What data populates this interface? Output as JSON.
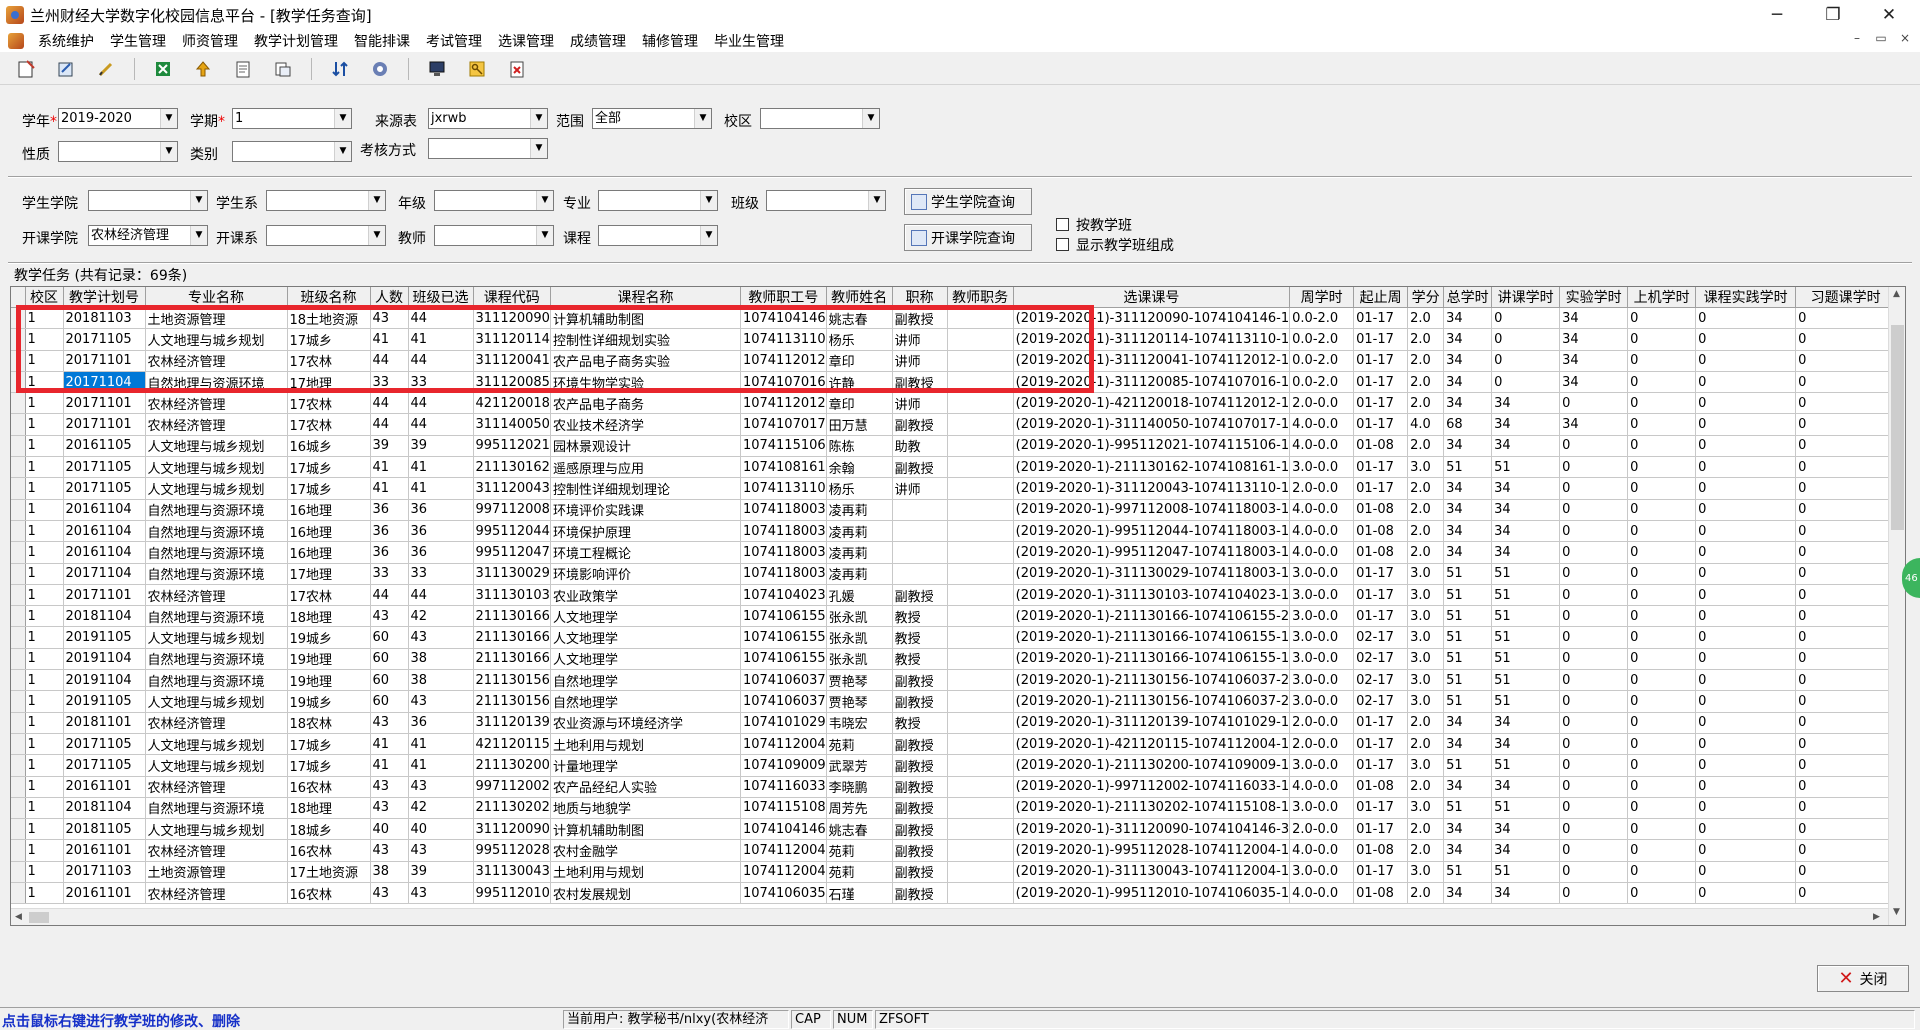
{
  "window": {
    "title": "兰州财经大学数字化校园信息平台 - [教学任务查询]",
    "minimize": "─",
    "maximize": "❐",
    "close": "✕"
  },
  "menu": [
    "系统维护",
    "学生管理",
    "师资管理",
    "教学计划管理",
    "智能排课",
    "考试管理",
    "选课管理",
    "成绩管理",
    "辅修管理",
    "毕业生管理"
  ],
  "mdi_controls": [
    "–",
    "▭",
    "×"
  ],
  "filters": {
    "year_label": "学年",
    "year_value": "2019-2020",
    "term_label": "学期",
    "term_value": "1",
    "source_label": "来源表",
    "source_value": "jxrwb",
    "scope_label": "范围",
    "scope_value": "全部",
    "campus_label": "校区",
    "campus_value": "",
    "nature_label": "性质",
    "nature_value": "",
    "category_label": "类别",
    "category_value": "",
    "exam_label": "考核方式",
    "exam_value": "",
    "stu_college_label": "学生学院",
    "stu_college_value": "",
    "stu_dept_label": "学生系",
    "stu_dept_value": "",
    "grade_label": "年级",
    "grade_value": "",
    "major_label": "专业",
    "major_value": "",
    "class_label": "班级",
    "class_value": "",
    "open_college_label": "开课学院",
    "open_college_value": "农林经济管理",
    "open_dept_label": "开课系",
    "open_dept_value": "",
    "teacher_label": "教师",
    "teacher_value": "",
    "course_label": "课程",
    "course_value": "",
    "stu_college_query": "学生学院查询",
    "open_college_query": "开课学院查询",
    "by_class_label": "按教学班",
    "show_class_label": "显示教学班组成"
  },
  "grid": {
    "caption": "教学任务 (共有记录：69条)",
    "columns": [
      "校区",
      "教学计划号",
      "专业名称",
      "班级名称",
      "人数",
      "班级已选",
      "课程代码",
      "课程名称",
      "教师职工号",
      "教师姓名",
      "职称",
      "教师职务",
      "选课课号",
      "周学时",
      "起止周",
      "学分",
      "总学时",
      "讲课学时",
      "实验学时",
      "上机学时",
      "课程实践学时",
      "习题课学时"
    ],
    "selected_row": 3,
    "rows": [
      [
        "1",
        "20181103",
        "土地资源管理",
        "18土地资源",
        "43",
        "44",
        "311120090",
        "计算机辅助制图",
        "1074104146",
        "姚志春",
        "副教授",
        "",
        "(2019-2020-1)-311120090-1074104146-1",
        "0.0-2.0",
        "01-17",
        "2.0",
        "34",
        "0",
        "34",
        "0",
        "0",
        "0"
      ],
      [
        "1",
        "20171105",
        "人文地理与城乡规划",
        "17城乡",
        "41",
        "41",
        "311120114",
        "控制性详细规划实验",
        "1074113110",
        "杨乐",
        "讲师",
        "",
        "(2019-2020-1)-311120114-1074113110-1",
        "0.0-2.0",
        "01-17",
        "2.0",
        "34",
        "0",
        "34",
        "0",
        "0",
        "0"
      ],
      [
        "1",
        "20171101",
        "农林经济管理",
        "17农林",
        "44",
        "44",
        "311120041",
        "农产品电子商务实验",
        "1074112012",
        "章印",
        "讲师",
        "",
        "(2019-2020-1)-311120041-1074112012-1",
        "0.0-2.0",
        "01-17",
        "2.0",
        "34",
        "0",
        "34",
        "0",
        "0",
        "0"
      ],
      [
        "1",
        "20171104",
        "自然地理与资源环境",
        "17地理",
        "33",
        "33",
        "311120085",
        "环境生物学实验",
        "1074107016",
        "许静",
        "副教授",
        "",
        "(2019-2020-1)-311120085-1074107016-1",
        "0.0-2.0",
        "01-17",
        "2.0",
        "34",
        "0",
        "34",
        "0",
        "0",
        "0"
      ],
      [
        "1",
        "20171101",
        "农林经济管理",
        "17农林",
        "44",
        "44",
        "421120018",
        "农产品电子商务",
        "1074112012",
        "章印",
        "讲师",
        "",
        "(2019-2020-1)-421120018-1074112012-1",
        "2.0-0.0",
        "01-17",
        "2.0",
        "34",
        "34",
        "0",
        "0",
        "0",
        "0"
      ],
      [
        "1",
        "20171101",
        "农林经济管理",
        "17农林",
        "44",
        "44",
        "311140050",
        "农业技术经济学",
        "1074107017",
        "田万慧",
        "副教授",
        "",
        "(2019-2020-1)-311140050-1074107017-1",
        "4.0-0.0",
        "01-17",
        "4.0",
        "68",
        "34",
        "34",
        "0",
        "0",
        "0"
      ],
      [
        "1",
        "20161105",
        "人文地理与城乡规划",
        "16城乡",
        "39",
        "39",
        "995112021",
        "园林景观设计",
        "1074115106",
        "陈栋",
        "助教",
        "",
        "(2019-2020-1)-995112021-1074115106-1",
        "4.0-0.0",
        "01-08",
        "2.0",
        "34",
        "34",
        "0",
        "0",
        "0",
        "0"
      ],
      [
        "1",
        "20171105",
        "人文地理与城乡规划",
        "17城乡",
        "41",
        "41",
        "211130162",
        "遥感原理与应用",
        "1074108161",
        "余翰",
        "副教授",
        "",
        "(2019-2020-1)-211130162-1074108161-1",
        "3.0-0.0",
        "01-17",
        "3.0",
        "51",
        "51",
        "0",
        "0",
        "0",
        "0"
      ],
      [
        "1",
        "20171105",
        "人文地理与城乡规划",
        "17城乡",
        "41",
        "41",
        "311120043",
        "控制性详细规划理论",
        "1074113110",
        "杨乐",
        "讲师",
        "",
        "(2019-2020-1)-311120043-1074113110-1",
        "2.0-0.0",
        "01-17",
        "2.0",
        "34",
        "34",
        "0",
        "0",
        "0",
        "0"
      ],
      [
        "1",
        "20161104",
        "自然地理与资源环境",
        "16地理",
        "36",
        "36",
        "997112008",
        "环境评价实践课",
        "1074118003",
        "凌再莉",
        "",
        "",
        "(2019-2020-1)-997112008-1074118003-1",
        "4.0-0.0",
        "01-08",
        "2.0",
        "34",
        "34",
        "0",
        "0",
        "0",
        "0"
      ],
      [
        "1",
        "20161104",
        "自然地理与资源环境",
        "16地理",
        "36",
        "36",
        "995112044",
        "环境保护原理",
        "1074118003",
        "凌再莉",
        "",
        "",
        "(2019-2020-1)-995112044-1074118003-1",
        "4.0-0.0",
        "01-08",
        "2.0",
        "34",
        "34",
        "0",
        "0",
        "0",
        "0"
      ],
      [
        "1",
        "20161104",
        "自然地理与资源环境",
        "16地理",
        "36",
        "36",
        "995112047",
        "环境工程概论",
        "1074118003",
        "凌再莉",
        "",
        "",
        "(2019-2020-1)-995112047-1074118003-1",
        "4.0-0.0",
        "01-08",
        "2.0",
        "34",
        "34",
        "0",
        "0",
        "0",
        "0"
      ],
      [
        "1",
        "20171104",
        "自然地理与资源环境",
        "17地理",
        "33",
        "33",
        "311130029",
        "环境影响评价",
        "1074118003",
        "凌再莉",
        "",
        "",
        "(2019-2020-1)-311130029-1074118003-1",
        "3.0-0.0",
        "01-17",
        "3.0",
        "51",
        "51",
        "0",
        "0",
        "0",
        "0"
      ],
      [
        "1",
        "20171101",
        "农林经济管理",
        "17农林",
        "44",
        "44",
        "311130103",
        "农业政策学",
        "1074104023",
        "孔媛",
        "副教授",
        "",
        "(2019-2020-1)-311130103-1074104023-1",
        "3.0-0.0",
        "01-17",
        "3.0",
        "51",
        "51",
        "0",
        "0",
        "0",
        "0"
      ],
      [
        "1",
        "20181104",
        "自然地理与资源环境",
        "18地理",
        "43",
        "42",
        "211130166",
        "人文地理学",
        "1074106155",
        "张永凯",
        "教授",
        "",
        "(2019-2020-1)-211130166-1074106155-2",
        "3.0-0.0",
        "01-17",
        "3.0",
        "51",
        "51",
        "0",
        "0",
        "0",
        "0"
      ],
      [
        "1",
        "20191105",
        "人文地理与城乡规划",
        "19城乡",
        "60",
        "43",
        "211130166",
        "人文地理学",
        "1074106155",
        "张永凯",
        "教授",
        "",
        "(2019-2020-1)-211130166-1074106155-1",
        "3.0-0.0",
        "02-17",
        "3.0",
        "51",
        "51",
        "0",
        "0",
        "0",
        "0"
      ],
      [
        "1",
        "20191104",
        "自然地理与资源环境",
        "19地理",
        "60",
        "38",
        "211130166",
        "人文地理学",
        "1074106155",
        "张永凯",
        "教授",
        "",
        "(2019-2020-1)-211130166-1074106155-1",
        "3.0-0.0",
        "02-17",
        "3.0",
        "51",
        "51",
        "0",
        "0",
        "0",
        "0"
      ],
      [
        "1",
        "20191104",
        "自然地理与资源环境",
        "19地理",
        "60",
        "38",
        "211130156",
        "自然地理学",
        "1074106037",
        "贾艳琴",
        "副教授",
        "",
        "(2019-2020-1)-211130156-1074106037-2",
        "3.0-0.0",
        "02-17",
        "3.0",
        "51",
        "51",
        "0",
        "0",
        "0",
        "0"
      ],
      [
        "1",
        "20191105",
        "人文地理与城乡规划",
        "19城乡",
        "60",
        "43",
        "211130156",
        "自然地理学",
        "1074106037",
        "贾艳琴",
        "副教授",
        "",
        "(2019-2020-1)-211130156-1074106037-2",
        "3.0-0.0",
        "02-17",
        "3.0",
        "51",
        "51",
        "0",
        "0",
        "0",
        "0"
      ],
      [
        "1",
        "20181101",
        "农林经济管理",
        "18农林",
        "43",
        "36",
        "311120139",
        "农业资源与环境经济学",
        "1074101029",
        "韦晓宏",
        "教授",
        "",
        "(2019-2020-1)-311120139-1074101029-1",
        "2.0-0.0",
        "01-17",
        "2.0",
        "34",
        "34",
        "0",
        "0",
        "0",
        "0"
      ],
      [
        "1",
        "20171105",
        "人文地理与城乡规划",
        "17城乡",
        "41",
        "41",
        "421120115",
        "土地利用与规划",
        "1074112004",
        "苑莉",
        "副教授",
        "",
        "(2019-2020-1)-421120115-1074112004-1",
        "2.0-0.0",
        "01-17",
        "2.0",
        "34",
        "34",
        "0",
        "0",
        "0",
        "0"
      ],
      [
        "1",
        "20171105",
        "人文地理与城乡规划",
        "17城乡",
        "41",
        "41",
        "211130200",
        "计量地理学",
        "1074109009",
        "武翠芳",
        "副教授",
        "",
        "(2019-2020-1)-211130200-1074109009-1",
        "3.0-0.0",
        "01-17",
        "3.0",
        "51",
        "51",
        "0",
        "0",
        "0",
        "0"
      ],
      [
        "1",
        "20161101",
        "农林经济管理",
        "16农林",
        "43",
        "43",
        "997112002",
        "农产品经纪人实验",
        "1074116033",
        "李晓鹏",
        "副教授",
        "",
        "(2019-2020-1)-997112002-1074116033-1",
        "4.0-0.0",
        "01-08",
        "2.0",
        "34",
        "34",
        "0",
        "0",
        "0",
        "0"
      ],
      [
        "1",
        "20181104",
        "自然地理与资源环境",
        "18地理",
        "43",
        "42",
        "211130202",
        "地质与地貌学",
        "1074115108",
        "周芳先",
        "副教授",
        "",
        "(2019-2020-1)-211130202-1074115108-1",
        "3.0-0.0",
        "01-17",
        "3.0",
        "51",
        "51",
        "0",
        "0",
        "0",
        "0"
      ],
      [
        "1",
        "20181105",
        "人文地理与城乡规划",
        "18城乡",
        "40",
        "40",
        "311120090",
        "计算机辅助制图",
        "1074104146",
        "姚志春",
        "副教授",
        "",
        "(2019-2020-1)-311120090-1074104146-3",
        "2.0-0.0",
        "01-17",
        "2.0",
        "34",
        "34",
        "0",
        "0",
        "0",
        "0"
      ],
      [
        "1",
        "20161101",
        "农林经济管理",
        "16农林",
        "43",
        "43",
        "995112028",
        "农村金融学",
        "1074112004",
        "苑莉",
        "副教授",
        "",
        "(2019-2020-1)-995112028-1074112004-1",
        "4.0-0.0",
        "01-08",
        "2.0",
        "34",
        "34",
        "0",
        "0",
        "0",
        "0"
      ],
      [
        "1",
        "20171103",
        "土地资源管理",
        "17土地资源",
        "38",
        "39",
        "311130043",
        "土地利用与规划",
        "1074112004",
        "苑莉",
        "副教授",
        "",
        "(2019-2020-1)-311130043-1074112004-1",
        "3.0-0.0",
        "01-17",
        "3.0",
        "51",
        "51",
        "0",
        "0",
        "0",
        "0"
      ],
      [
        "1",
        "20161101",
        "农林经济管理",
        "16农林",
        "43",
        "43",
        "995112010",
        "农村发展规划",
        "1074106035",
        "石瑾",
        "副教授",
        "",
        "(2019-2020-1)-995112010-1074106035-1",
        "4.0-0.0",
        "01-08",
        "2.0",
        "34",
        "34",
        "0",
        "0",
        "0",
        "0"
      ]
    ]
  },
  "close_button": "关闭",
  "status": {
    "hint": "点击鼠标右键进行教学班的修改、删除",
    "user": "当前用户: 教学秘书/nlxy(农林经济",
    "cap": "CAP",
    "num": "NUM",
    "vendor": "ZFSOFT"
  },
  "side_badge": "46"
}
